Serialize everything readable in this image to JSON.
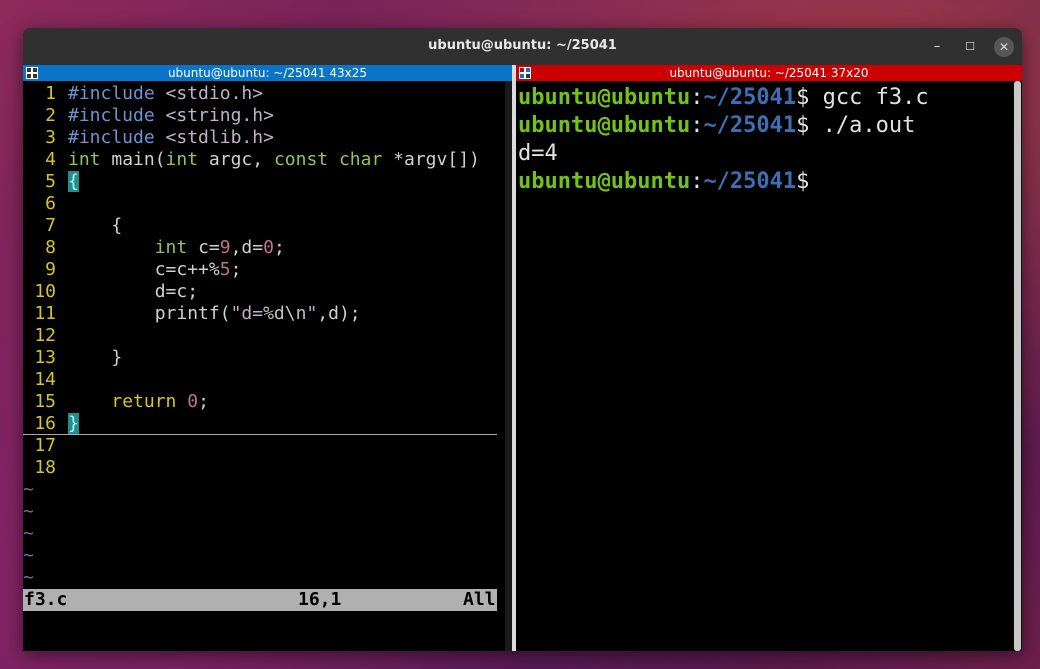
{
  "window": {
    "title": "ubuntu@ubuntu: ~/25041",
    "buttons": {
      "minimize": "–",
      "maximize": "☐",
      "close": "✕"
    }
  },
  "left_pane": {
    "header": "ubuntu@ubuntu: ~/25041 43x25",
    "header_color": "#0a74c8",
    "lines": [
      {
        "n": "1",
        "text": "#include <stdio.h>"
      },
      {
        "n": "2",
        "text": "#include <string.h>"
      },
      {
        "n": "3",
        "text": "#include <stdlib.h>"
      },
      {
        "n": "4",
        "text": "int main(int argc, const char *argv[])"
      },
      {
        "n": "5",
        "text": "{"
      },
      {
        "n": "6",
        "text": ""
      },
      {
        "n": "7",
        "text": "    {"
      },
      {
        "n": "8",
        "text": "        int c=9,d=0;"
      },
      {
        "n": "9",
        "text": "        c=c++%5;"
      },
      {
        "n": "10",
        "text": "        d=c;"
      },
      {
        "n": "11",
        "text": "        printf(\"d=%d\\n\",d);"
      },
      {
        "n": "12",
        "text": ""
      },
      {
        "n": "13",
        "text": "    }"
      },
      {
        "n": "14",
        "text": ""
      },
      {
        "n": "15",
        "text": "    return 0;"
      },
      {
        "n": "16",
        "text": "}"
      },
      {
        "n": "17",
        "text": ""
      },
      {
        "n": "18",
        "text": ""
      }
    ],
    "tilde": "~",
    "status": {
      "filename": "f3.c",
      "position": "16,1",
      "scroll": "All"
    }
  },
  "right_pane": {
    "header": "ubuntu@ubuntu: ~/25041 37x20",
    "header_color": "#cc0000",
    "prompt_user": "ubuntu@ubuntu",
    "prompt_path": "~/25041",
    "prompt_sep": ":",
    "prompt_symbol": "$",
    "commands": [
      " gcc f3.c",
      " ./a.out"
    ],
    "output": "d=4"
  }
}
